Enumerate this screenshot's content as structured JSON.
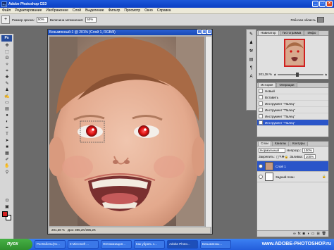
{
  "app": {
    "title": "Adobe Photoshop CS3"
  },
  "menu": [
    "Файл",
    "Редактирование",
    "Изображение",
    "Слой",
    "Выделение",
    "Фильтр",
    "Просмотр",
    "Окно",
    "Справка"
  ],
  "options": {
    "size_label": "Размер зрачка:",
    "size_value": "50%",
    "darken_label": "Величина затемнения:",
    "darken_value": "50%",
    "workspace_label": "Рабочая область"
  },
  "toolbox": {
    "logo": "Ps",
    "foreground": "#d42020",
    "background": "#ffffff"
  },
  "document": {
    "title": "Безымянный-1 @ 201% (Слой 1, RGB/8)",
    "zoom": "201,38 %",
    "doc_info": "Док: 395,2K/395,2K"
  },
  "navigator": {
    "tabs": [
      "Навигатор",
      "Гистограмма",
      "Инфо"
    ],
    "zoom": "201,38 %"
  },
  "history": {
    "tabs": [
      "История",
      "Операции"
    ],
    "items": [
      "Новый",
      "Вставить",
      "Инструмент \"Палец\"",
      "Инструмент \"Палец\"",
      "Инструмент \"Палец\"",
      "Инструмент \"Палец\""
    ],
    "selected_index": 5
  },
  "layers": {
    "tabs": [
      "Слои",
      "Каналы",
      "Контуры"
    ],
    "blend_mode": "Нормальный",
    "opacity_label": "Непрозр.:",
    "opacity": "100%",
    "lock_label": "Закрепить:",
    "fill_label": "Заливка:",
    "fill": "100%",
    "items": [
      {
        "name": "Слой 1",
        "selected": true
      },
      {
        "name": "Задний план",
        "selected": false
      }
    ]
  },
  "taskbar": {
    "start": "пуск",
    "items": [
      "РосКабель(Ск...",
      "3 Microsoft ...",
      "Оптимизация...",
      "Как убрать э...",
      "Adobe Photo...",
      "Безымянны..."
    ],
    "active_index": 4,
    "watermark": "www.ADOBE-PHOTOSHOP.ru"
  }
}
